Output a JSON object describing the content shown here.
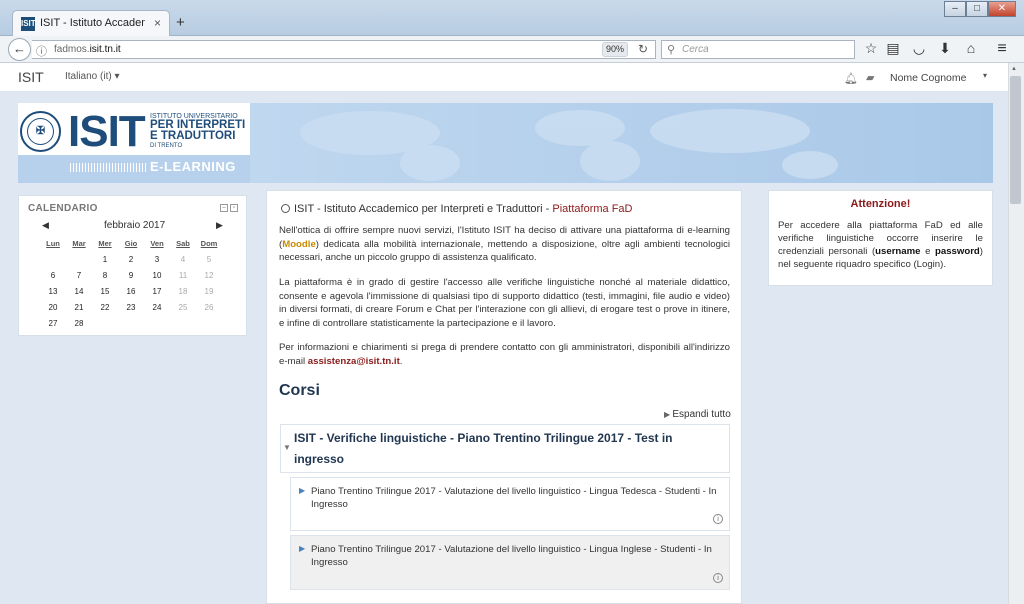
{
  "browser": {
    "tab_title": "ISIT - Istituto Accademico ...",
    "tab_favicon": "ISIT",
    "tab_close": "×",
    "new_tab": "+",
    "url_prefix": "fadmos.",
    "url_domain": "isit.tn.it",
    "zoom": "90%",
    "search_placeholder": "Cerca"
  },
  "navbar": {
    "brand": "ISIT",
    "language": "Italiano (it) ▾",
    "user": "Nome Cognome"
  },
  "banner": {
    "logo": "ISIT",
    "subtitle_top": "ISTITUTO UNIVERSITARIO",
    "subtitle_main_1": "PER INTERPRETI",
    "subtitle_main_2": "E TRADUTTORI",
    "subtitle_city": "DI TRENTO",
    "elearning": "E-LEARNING"
  },
  "calendar": {
    "title": "CALENDARIO",
    "month": "febbraio 2017",
    "days": [
      "Lun",
      "Mar",
      "Mer",
      "Gio",
      "Ven",
      "Sab",
      "Dom"
    ],
    "weeks": [
      [
        "",
        "",
        "1",
        "2",
        "3",
        "4",
        "5"
      ],
      [
        "6",
        "7",
        "8",
        "9",
        "10",
        "11",
        "12"
      ],
      [
        "13",
        "14",
        "15",
        "16",
        "17",
        "18",
        "19"
      ],
      [
        "20",
        "21",
        "22",
        "23",
        "24",
        "25",
        "26"
      ],
      [
        "27",
        "28",
        "",
        "",
        "",
        "",
        ""
      ]
    ]
  },
  "main": {
    "site_title": "ISIT - Istituto Accademico per Interpreti e Traduttori - ",
    "site_title_highlight": "Piattaforma FaD",
    "p1_a": "Nell'ottica di offrire sempre nuovi servizi, l'Istituto ISIT ha deciso di attivare una piattaforma di e-learning (",
    "p1_moodle": "Moodle",
    "p1_b": ") dedicata alla mobilità internazionale, mettendo a disposizione, oltre agli ambienti tecnologici necessari, anche un piccolo gruppo di assistenza qualificato.",
    "p2": "La piattaforma è in grado di gestire l'accesso alle verifiche linguistiche nonché al materiale didattico, consente e agevola l'immissione di qualsiasi tipo di supporto didattico (testi, immagini, file audio e video) in diversi formati, di creare Forum e Chat per l'interazione con gli allievi, di erogare test o prove in itinere, e infine di controllare statisticamente la partecipazione e il lavoro.",
    "p3_a": "Per informazioni e chiarimenti si prega di prendere contatto con gli amministratori, disponibili all'indirizzo e-mail ",
    "p3_mail": "assistenza@isit.tn.it",
    "p3_b": ".",
    "courses_heading": "Corsi",
    "expand_all": "Espandi tutto",
    "category_title": "ISIT - Verifiche linguistiche - Piano Trentino Trilingue 2017 - Test in ingresso",
    "courses": [
      "Piano Trentino Trilingue 2017 - Valutazione del livello linguistico - Lingua Tedesca - Studenti - In Ingresso",
      "Piano Trentino Trilingue 2017 - Valutazione del livello linguistico - Lingua Inglese - Studenti - In Ingresso"
    ]
  },
  "attention": {
    "title": "Attenzione!",
    "text_a": "Per accedere alla piattaforma FaD ed alle verifiche linguistiche occorre inserire le credenziali personali (",
    "username": "username",
    "text_b": " e ",
    "password": "password",
    "text_c": ") nel seguente riquadro specifico (Login)."
  },
  "colors": {
    "brand_blue": "#1f4d7b",
    "accent_red": "#8b1a1a",
    "moodle_orange": "#c88a00",
    "page_bg": "#dfe8f2"
  }
}
